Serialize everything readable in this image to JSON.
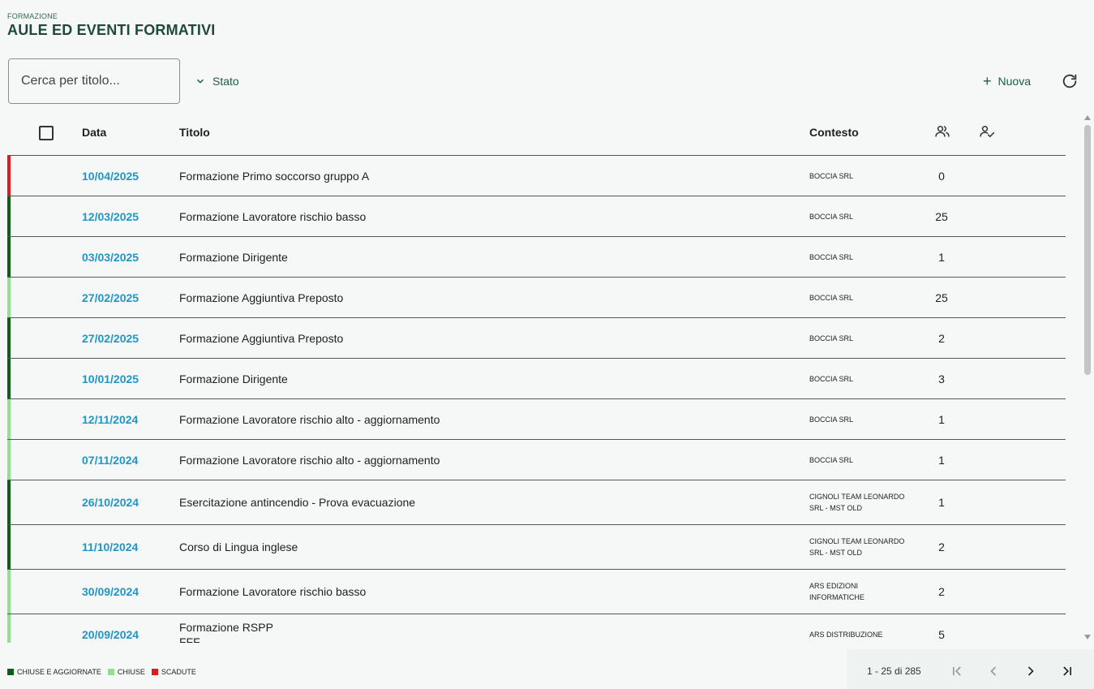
{
  "header": {
    "breadcrumb": "FORMAZIONE",
    "title": "AULE ED EVENTI FORMATIVI"
  },
  "search": {
    "placeholder": "Cerca per titolo...",
    "value": ""
  },
  "filters": {
    "stato_label": "Stato"
  },
  "toolbar": {
    "new_label": "Nuova"
  },
  "table": {
    "headers": {
      "date": "Data",
      "title": "Titolo",
      "context": "Contesto"
    },
    "header_icons": [
      "participants-icon",
      "attendance-check-icon"
    ],
    "rows": [
      {
        "date": "10/04/2025",
        "title": "Formazione Primo soccorso gruppo A",
        "subtitle": "",
        "context": "BOCCIA SRL",
        "count": "0",
        "status": "scadute"
      },
      {
        "date": "12/03/2025",
        "title": "Formazione Lavoratore rischio basso",
        "subtitle": "",
        "context": "BOCCIA SRL",
        "count": "25",
        "status": "chiuse_aggiornate"
      },
      {
        "date": "03/03/2025",
        "title": "Formazione Dirigente",
        "subtitle": "",
        "context": "BOCCIA SRL",
        "count": "1",
        "status": "chiuse_aggiornate"
      },
      {
        "date": "27/02/2025",
        "title": "Formazione Aggiuntiva Preposto",
        "subtitle": "",
        "context": "BOCCIA SRL",
        "count": "25",
        "status": "chiuse"
      },
      {
        "date": "27/02/2025",
        "title": "Formazione Aggiuntiva Preposto",
        "subtitle": "",
        "context": "BOCCIA SRL",
        "count": "2",
        "status": "chiuse_aggiornate"
      },
      {
        "date": "10/01/2025",
        "title": "Formazione Dirigente",
        "subtitle": "",
        "context": "BOCCIA SRL",
        "count": "3",
        "status": "chiuse_aggiornate"
      },
      {
        "date": "12/11/2024",
        "title": "Formazione Lavoratore rischio alto - aggiornamento",
        "subtitle": "",
        "context": "BOCCIA SRL",
        "count": "1",
        "status": "chiuse"
      },
      {
        "date": "07/11/2024",
        "title": "Formazione Lavoratore rischio alto - aggiornamento",
        "subtitle": "",
        "context": "BOCCIA SRL",
        "count": "1",
        "status": "chiuse"
      },
      {
        "date": "26/10/2024",
        "title": "Esercitazione antincendio - Prova evacuazione",
        "subtitle": "",
        "context": "CIGNOLI TEAM LEONARDO SRL - MST OLD",
        "count": "1",
        "status": "chiuse_aggiornate"
      },
      {
        "date": "11/10/2024",
        "title": "Corso di Lingua inglese",
        "subtitle": "",
        "context": "CIGNOLI TEAM LEONARDO SRL - MST OLD",
        "count": "2",
        "status": "chiuse_aggiornate"
      },
      {
        "date": "30/09/2024",
        "title": "Formazione Lavoratore rischio basso",
        "subtitle": "",
        "context": "ARS EDIZIONI INFORMATICHE",
        "count": "2",
        "status": "chiuse"
      },
      {
        "date": "20/09/2024",
        "title": "Formazione RSPP",
        "subtitle": "FFF",
        "context": "ARS DISTRIBUZIONE",
        "count": "5",
        "status": "chiuse"
      }
    ]
  },
  "legend": {
    "chiuse_aggiornate": "CHIUSE E AGGIORNATE",
    "chiuse": "CHIUSE",
    "scadute": "SCADUTE"
  },
  "colors": {
    "chiuse_aggiornate": "#0d5c17",
    "chiuse": "#90e08f",
    "scadute": "#e01b1b",
    "date_link": "#2196c6",
    "accent": "#1f5a46"
  },
  "pagination": {
    "range": "1 - 25 di 285"
  }
}
